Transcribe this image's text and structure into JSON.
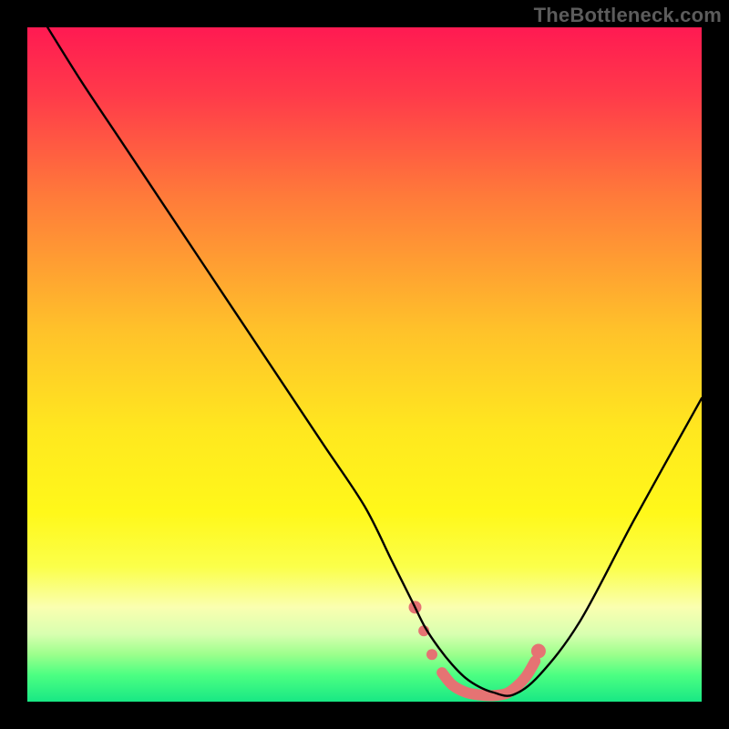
{
  "watermark": {
    "text": "TheBottleneck.com"
  },
  "gradient": {
    "stops": [
      {
        "offset": 0.0,
        "color": "#ff1a52"
      },
      {
        "offset": 0.1,
        "color": "#ff3a4a"
      },
      {
        "offset": 0.25,
        "color": "#ff7a3a"
      },
      {
        "offset": 0.45,
        "color": "#ffc22a"
      },
      {
        "offset": 0.6,
        "color": "#ffe81f"
      },
      {
        "offset": 0.72,
        "color": "#fff81a"
      },
      {
        "offset": 0.8,
        "color": "#fbff4a"
      },
      {
        "offset": 0.86,
        "color": "#faffb0"
      },
      {
        "offset": 0.9,
        "color": "#d8ffb0"
      },
      {
        "offset": 0.93,
        "color": "#9cff8c"
      },
      {
        "offset": 0.96,
        "color": "#4dff82"
      },
      {
        "offset": 1.0,
        "color": "#18e884"
      }
    ]
  },
  "chart_data": {
    "type": "line",
    "title": "",
    "xlabel": "",
    "ylabel": "",
    "xlim": [
      0,
      100
    ],
    "ylim": [
      0,
      100
    ],
    "grid": false,
    "series": [
      {
        "name": "bottleneck-curve",
        "color": "#000000",
        "width": 2.4,
        "x": [
          3,
          8,
          14,
          20,
          26,
          32,
          38,
          44,
          50,
          54,
          57,
          59,
          61,
          63,
          65,
          67,
          69,
          72,
          76,
          82,
          90,
          100
        ],
        "y": [
          100,
          92,
          83,
          74,
          65,
          56,
          47,
          38,
          29,
          21,
          15,
          11,
          8,
          5.5,
          3.5,
          2.2,
          1.4,
          1.0,
          4,
          12,
          27,
          45
        ]
      }
    ],
    "highlight": {
      "name": "optimal-range",
      "color": "#e57373",
      "stroke_width": 12,
      "dots": [
        {
          "x": 57.5,
          "y": 14.0,
          "r": 7
        },
        {
          "x": 58.8,
          "y": 10.5,
          "r": 6
        },
        {
          "x": 60.0,
          "y": 7.0,
          "r": 6
        }
      ],
      "band": {
        "x": [
          61.5,
          63,
          65,
          67,
          69,
          71,
          72.5,
          74,
          75.3
        ],
        "y": [
          4.3,
          2.5,
          1.4,
          1.0,
          0.9,
          1.2,
          2.2,
          3.8,
          6.0
        ]
      },
      "end_dot": {
        "x": 75.8,
        "y": 7.5,
        "r": 8
      }
    }
  }
}
